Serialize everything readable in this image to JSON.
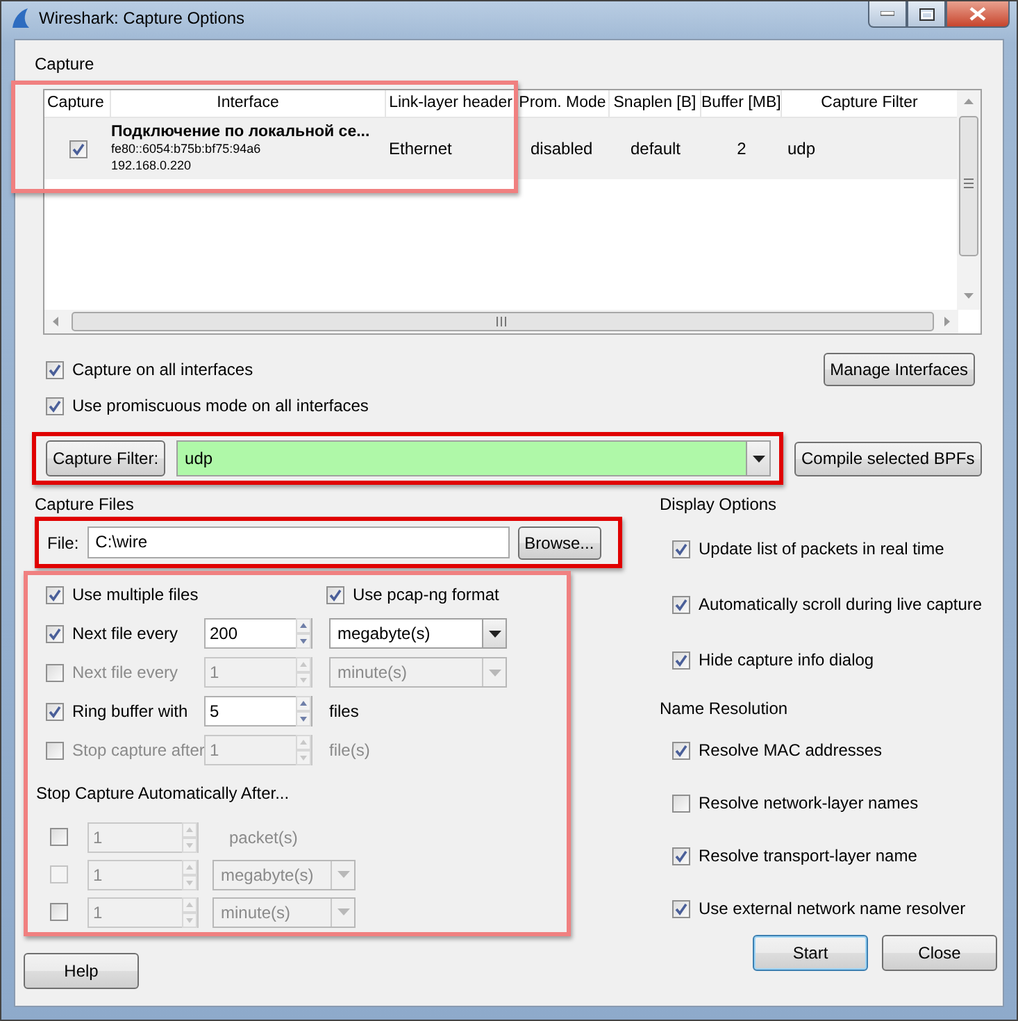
{
  "window": {
    "title": "Wireshark: Capture Options"
  },
  "capture": {
    "label": "Capture",
    "table": {
      "columns": [
        "Capture",
        "Interface",
        "Link-layer header",
        "Prom. Mode",
        "Snaplen [B]",
        "Buffer [MB]",
        "Capture Filter"
      ],
      "rows": [
        {
          "checked": true,
          "name": "Подключение по локальной се...",
          "address": "fe80::6054:b75b:bf75:94a6",
          "ip": "192.168.0.220",
          "link_layer": "Ethernet",
          "prom_mode": "disabled",
          "snaplen": "default",
          "buffer": "2",
          "filter": "udp"
        }
      ]
    },
    "options": [
      {
        "label": "Capture on all interfaces",
        "checked": true
      },
      {
        "label": "Use promiscuous mode on all interfaces",
        "checked": true
      }
    ],
    "manage_button": "Manage Interfaces",
    "filter": {
      "button": "Capture Filter:",
      "value": "udp"
    },
    "compile_button": "Compile selected BPFs"
  },
  "capture_files": {
    "label": "Capture Files",
    "file": {
      "label": "File:",
      "value": "C:\\wire",
      "browse": "Browse..."
    },
    "multiple": {
      "label": "Use multiple files",
      "checked": true
    },
    "pcapng": {
      "label": "Use pcap-ng format",
      "checked": true
    },
    "rows": [
      {
        "kind": "combo",
        "checked": true,
        "disabled": false,
        "label": "Next file every",
        "value": "200",
        "unit": "megabyte(s)"
      },
      {
        "kind": "combo",
        "checked": false,
        "disabled": true,
        "label": "Next file every",
        "value": "1",
        "unit": "minute(s)"
      },
      {
        "kind": "text",
        "checked": true,
        "disabled": false,
        "label": "Ring buffer with",
        "value": "5",
        "unit": "files"
      },
      {
        "kind": "text",
        "checked": false,
        "disabled": true,
        "label": "Stop capture after",
        "value": "1",
        "unit": "file(s)"
      }
    ],
    "stop_label": "Stop Capture Automatically After...",
    "stop_rows": [
      {
        "kind": "text",
        "checked": false,
        "checkbox_disabled": false,
        "value": "1",
        "unit": "packet(s)"
      },
      {
        "kind": "combo",
        "checked": false,
        "checkbox_disabled": true,
        "value": "1",
        "unit": "megabyte(s)"
      },
      {
        "kind": "combo",
        "checked": false,
        "checkbox_disabled": false,
        "value": "1",
        "unit": "minute(s)"
      }
    ]
  },
  "display_options": {
    "label": "Display Options",
    "items": [
      {
        "label": "Update list of packets in real time",
        "checked": true
      },
      {
        "label": "Automatically scroll during live capture",
        "checked": true
      },
      {
        "label": "Hide capture info dialog",
        "checked": true
      }
    ]
  },
  "name_resolution": {
    "label": "Name Resolution",
    "items": [
      {
        "label": "Resolve MAC addresses",
        "checked": true
      },
      {
        "label": "Resolve network-layer names",
        "checked": false
      },
      {
        "label": "Resolve transport-layer name",
        "checked": true
      },
      {
        "label": "Use external network name resolver",
        "checked": true
      }
    ]
  },
  "buttons": {
    "help": "Help",
    "start": "Start",
    "close": "Close"
  }
}
